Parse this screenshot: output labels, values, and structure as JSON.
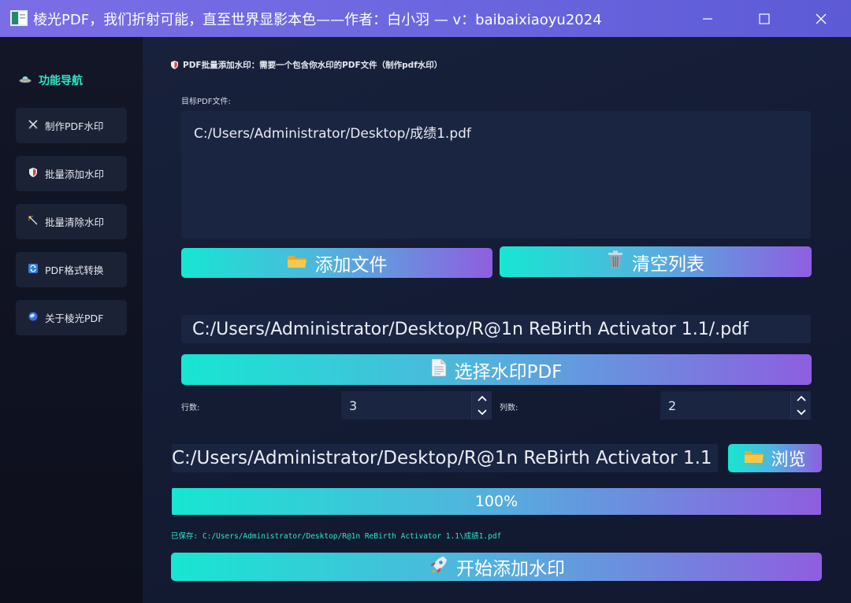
{
  "window": {
    "title": "棱光PDF，我们折射可能，直至世界显影本色——作者：白小羽 — v：baibaixiaoyu2024"
  },
  "sidebar": {
    "title": "功能导航",
    "title_icon": "ufo-icon",
    "items": [
      {
        "label": "制作PDF水印",
        "icon": "crossed-swords-icon"
      },
      {
        "label": "批量添加水印",
        "icon": "shield-icon"
      },
      {
        "label": "批量清除水印",
        "icon": "magic-wand-icon"
      },
      {
        "label": "PDF格式转换",
        "icon": "refresh-icon"
      },
      {
        "label": "关于棱光PDF",
        "icon": "prism-icon"
      }
    ]
  },
  "main": {
    "header": "PDF批量添加水印：需要一个包含你水印的PDF文件（制作pdf水印）",
    "target_label": "目标PDF文件:",
    "file_list": [
      "C:/Users/Administrator/Desktop/成绩1.pdf"
    ],
    "add_files_button": "添加文件",
    "clear_list_button": "清空列表",
    "watermark_path": "C:/Users/Administrator/Desktop/R@1n ReBirth Activator 1.1/.pdf",
    "select_watermark_button": "选择水印PDF",
    "rows_label": "行数:",
    "rows_value": "3",
    "cols_label": "列数:",
    "cols_value": "2",
    "output_path": "C:/Users/Administrator/Desktop/R@1n ReBirth Activator 1.1",
    "browse_button": "浏览",
    "progress": {
      "percent": 100,
      "label": "100%"
    },
    "saved_message": "已保存: C:/Users/Administrator/Desktop/R@1n ReBirth Activator 1.1\\成绩1.pdf",
    "start_button": "开始添加水印"
  },
  "colors": {
    "accent_start": "#17e6d2",
    "accent_end": "#8e5ee0",
    "title_bar": "#6c67e0",
    "nav_title": "#2ee6c8"
  }
}
